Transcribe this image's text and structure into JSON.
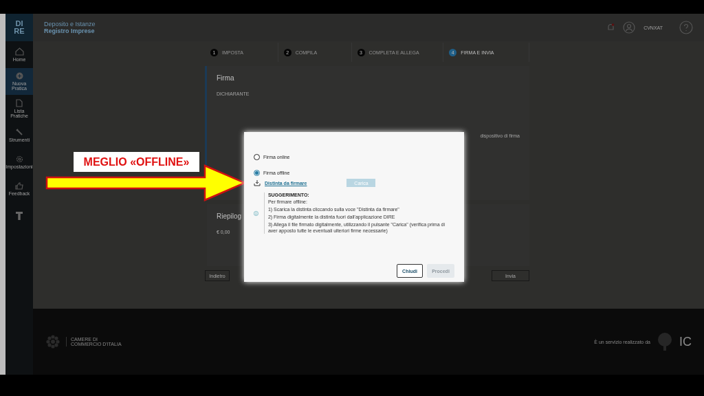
{
  "annotation": {
    "label": "MEGLIO «OFFLINE»"
  },
  "sidebar": {
    "logo": [
      "DI",
      "RE"
    ],
    "items": [
      {
        "label": "Home",
        "selected": false
      },
      {
        "label": "Nuova Pratica",
        "selected": true
      },
      {
        "label": "Lista Pratiche",
        "selected": false
      },
      {
        "label": "Strumenti",
        "selected": false
      },
      {
        "label": "Impostazioni",
        "selected": false
      },
      {
        "label": "Feedback",
        "selected": false
      },
      {
        "selected": false
      }
    ]
  },
  "header": {
    "title": "Deposito e Istanze",
    "subtitle": "Registro Imprese",
    "user": "CVNXAT"
  },
  "steps": [
    {
      "number": "1",
      "label": "IMPOSTA",
      "selected": false
    },
    {
      "number": "2",
      "label": "COMPILA",
      "selected": false
    },
    {
      "number": "3",
      "label": "COMPLETA E ALLEGA",
      "selected": false
    },
    {
      "number": "4",
      "label": "FIRMA E INVIA",
      "selected": true
    }
  ],
  "card": {
    "title": "Firma",
    "section": "DICHIARANTE",
    "note": "dispositivo di firma"
  },
  "summary": {
    "title": "Riepilog",
    "amount": "€ 0,00"
  },
  "nav_buttons": [
    {
      "label": "Indietro"
    },
    {
      "label": "Invia"
    }
  ],
  "footer": {
    "org": "CAMERE DI COMMERCIO D'ITALIA",
    "credit": "È un servizio realizzato da",
    "brand": "IC"
  },
  "dialog": {
    "options": [
      {
        "label": "Firma online",
        "selected": false
      },
      {
        "label": "Firma offline",
        "selected": true
      }
    ],
    "download": "Distinta da firmare",
    "upload": {
      "label": "Carica",
      "disabled": true
    },
    "tip_title": "SUGGERIMENTO:",
    "tip_lines": [
      "Per firmare offline:",
      "1) Scarica la distinta cliccando sulla voce \"Distinta da firmare\"",
      "2) Firma digitalmente la distinta fuori dall'applicazione DIRE",
      "3) Allega il file firmato digitalmente, utilizzando il pulsante \"Carica\" (verifica prima di aver apposto tutte le eventuali ulteriori firme necessarie)"
    ],
    "buttons": [
      {
        "label": "Chiudi",
        "disabled": false
      },
      {
        "label": "Procedi",
        "disabled": true
      }
    ]
  }
}
